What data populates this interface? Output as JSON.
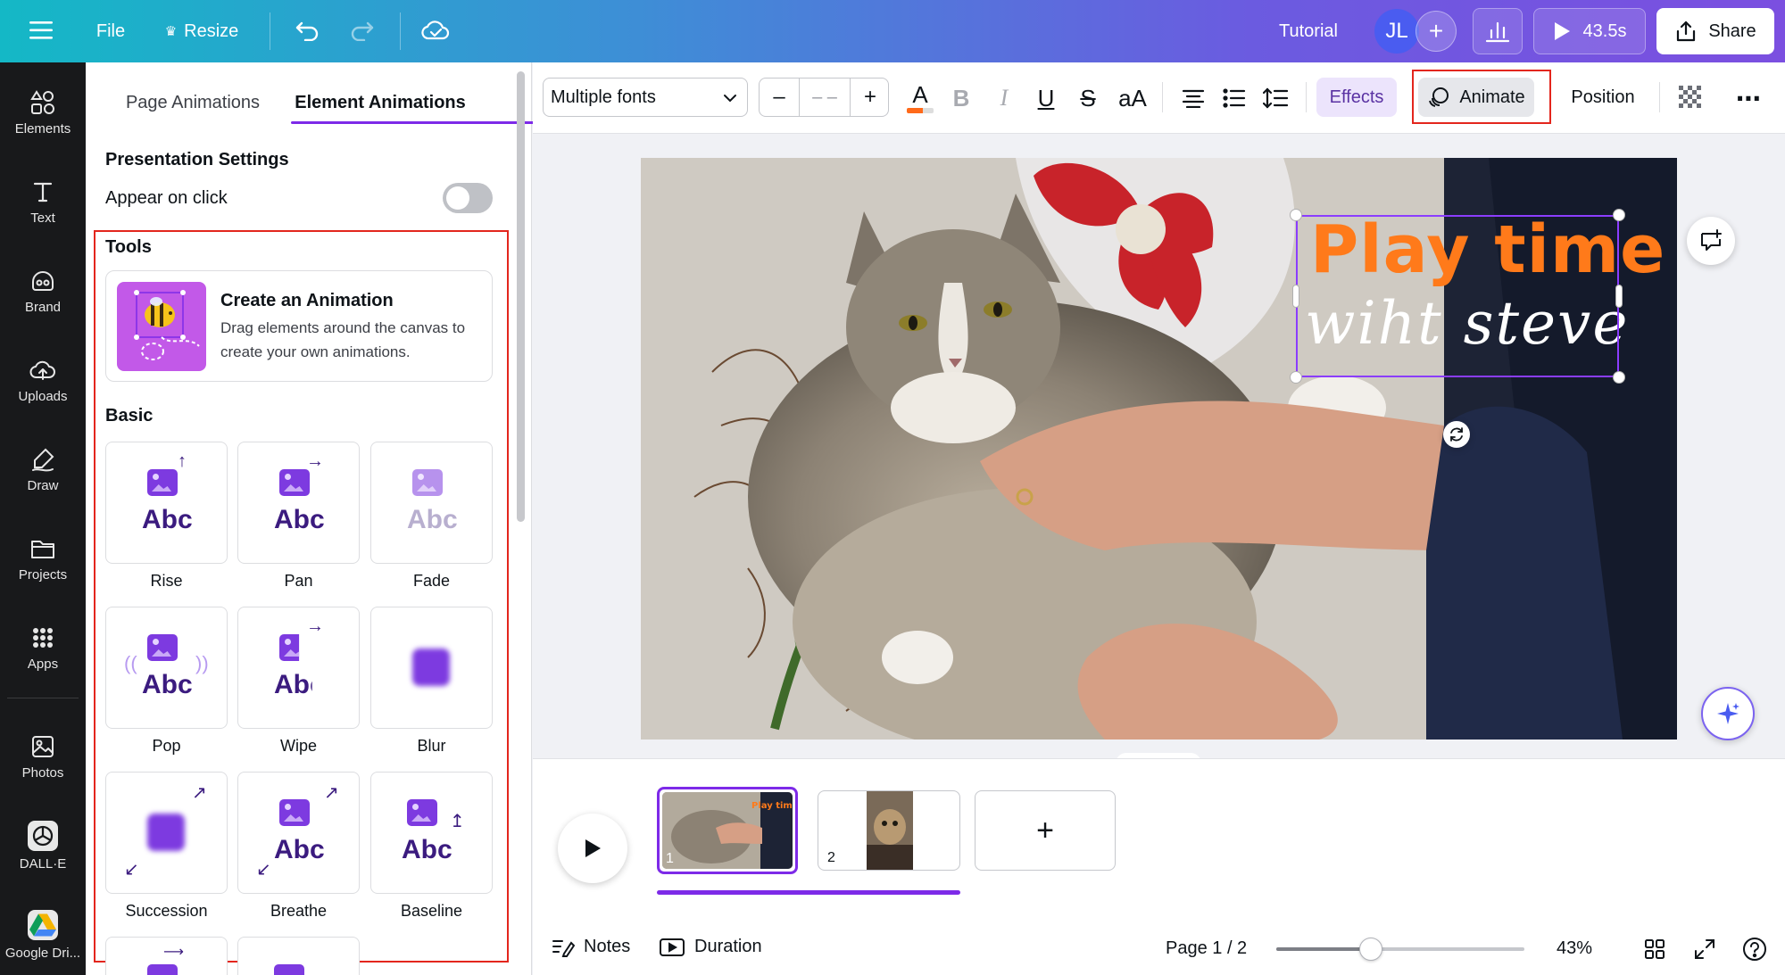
{
  "topbar": {
    "file_label": "File",
    "resize_label": "Resize",
    "tutorial_label": "Tutorial",
    "avatar_initials": "JL",
    "play_duration": "43.5s",
    "share_label": "Share"
  },
  "rail": {
    "items": [
      {
        "label": "Elements",
        "icon": "elements-icon"
      },
      {
        "label": "Text",
        "icon": "text-icon"
      },
      {
        "label": "Brand",
        "icon": "brand-icon"
      },
      {
        "label": "Uploads",
        "icon": "cloud-upload-icon"
      },
      {
        "label": "Draw",
        "icon": "draw-icon"
      },
      {
        "label": "Projects",
        "icon": "folder-icon"
      },
      {
        "label": "Apps",
        "icon": "apps-grid-icon"
      },
      {
        "label": "Photos",
        "icon": "photo-icon"
      },
      {
        "label": "DALL·E",
        "icon": "dalle-icon"
      },
      {
        "label": "Google Dri...",
        "icon": "google-drive-icon"
      }
    ]
  },
  "panel": {
    "tabs": [
      "Page Animations",
      "Element Animations"
    ],
    "active_tab": "Element Animations",
    "presentation_title": "Presentation Settings",
    "appear_on_click": "Appear on click",
    "tools_title": "Tools",
    "create": {
      "title": "Create an Animation",
      "desc_line1": "Drag elements around the canvas to",
      "desc_line2": "create your own animations."
    },
    "basic_title": "Basic",
    "animations": [
      "Rise",
      "Pan",
      "Fade",
      "Pop",
      "Wipe",
      "Blur",
      "Succession",
      "Breathe",
      "Baseline"
    ],
    "abc_text": "Abc"
  },
  "editor_toolbar": {
    "font": "Multiple fonts",
    "size_placeholder": "– –",
    "effects_label": "Effects",
    "animate_label": "Animate",
    "position_label": "Position"
  },
  "canvas": {
    "text_line1": "Play time",
    "text_line2": "wiht steve"
  },
  "pages": {
    "numbers": [
      "1",
      "2"
    ]
  },
  "status": {
    "notes_label": "Notes",
    "duration_label": "Duration",
    "page_indicator": "Page 1 / 2",
    "zoom": "43%",
    "zoom_fraction": 0.38
  },
  "colors": {
    "accent": "#7d2ae8",
    "highlight": "#e3261d",
    "text_orange": "#ff7a1a"
  }
}
